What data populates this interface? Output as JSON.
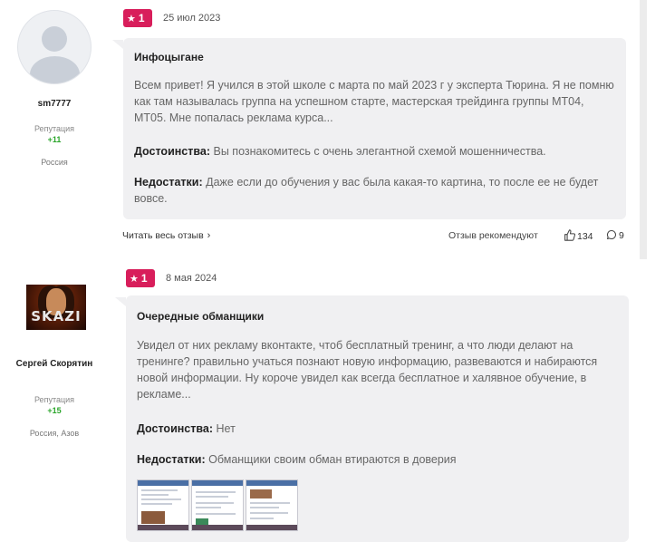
{
  "reviews": [
    {
      "author": {
        "name": "sm7777",
        "reputation_label": "Репутация",
        "reputation": "+11",
        "location": "Россия"
      },
      "rating": "1",
      "date": "25 июл 2023",
      "title": "Инфоцыгане",
      "text": "Всем привет! Я учился в этой школе с марта по май 2023 г у эксперта Тюрина. Я не помню как там называлась группа на успешном старте, мастерская трейдинга группы МТ04, МТ05. Мне попалась реклама курса...",
      "pros_label": "Достоинства:",
      "pros": "Вы познакомитесь с очень элегантной схемой мошенничества.",
      "cons_label": "Недостатки:",
      "cons": "Даже если до обучения у вас была какая-то картина, то после ее не будет вовсе.",
      "read_more": "Читать весь отзыв",
      "recommend_label": "Отзыв рекомендуют",
      "likes": "134",
      "comments": "9"
    },
    {
      "author": {
        "name": "Сергей Скорятин",
        "avatar_text": "SKAZI",
        "reputation_label": "Репутация",
        "reputation": "+15",
        "location": "Россия, Азов"
      },
      "rating": "1",
      "date": "8 мая 2024",
      "title": "Очередные обманщики",
      "text": "Увидел от них рекламу вконтакте, чтоб бесплатный тренинг, а что люди делают на тренинге? правильно учаться познают новую информацию, развеваются и набираются новой информации. Ну короче увидел как всегда бесплатное и халявное обучение, в рекламе...",
      "pros_label": "Достоинства:",
      "pros": "Нет",
      "cons_label": "Недостатки:",
      "cons": "Обманщики своим обман втираются в доверия"
    }
  ],
  "icons": {
    "rating": "star-icon",
    "read_more": "chevron-right-icon",
    "likes": "thumbs-up-icon",
    "comments": "comment-icon"
  },
  "colors": {
    "rating_badge": "#d81e5b",
    "reputation": "#2aa52a",
    "bubble": "#f0f0f2"
  }
}
